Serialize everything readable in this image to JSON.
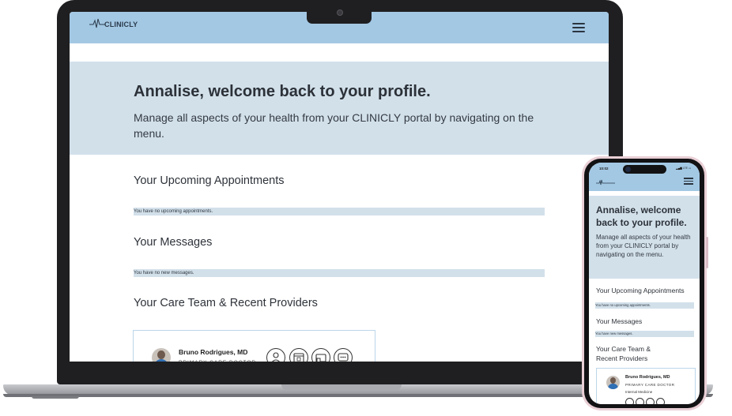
{
  "app": {
    "logo_text": "CLINICLY",
    "menu_icon": "hamburger-menu-icon"
  },
  "hero": {
    "title": "Annalise, welcome back to your profile.",
    "subtitle": "Manage all aspects of your health from your CLINICLY portal by navigating on the menu."
  },
  "sections": {
    "appointments": {
      "heading": "Your Upcoming Appointments",
      "empty_text": "You have no upcoming appointments."
    },
    "messages": {
      "heading": "Your Messages",
      "empty_text": "You have no new messages.",
      "mobile_empty_text": "You have new messages."
    },
    "care_team": {
      "heading": "Your Care Team & Recent Providers"
    }
  },
  "provider": {
    "name": "Bruno Rodrigues, MD",
    "role": "PRIMARY CARE DOCTOR",
    "specialty": "Internal Medicine",
    "action_icons": [
      "doctor-icon",
      "calendar-icon",
      "video-icon",
      "chat-icon"
    ]
  },
  "phone_status": {
    "time": "10:02",
    "signal": "LTE"
  },
  "colors": {
    "header": "#a3c8e4",
    "hero": "#d2e0ea",
    "card_border": "#bcd6ea"
  }
}
